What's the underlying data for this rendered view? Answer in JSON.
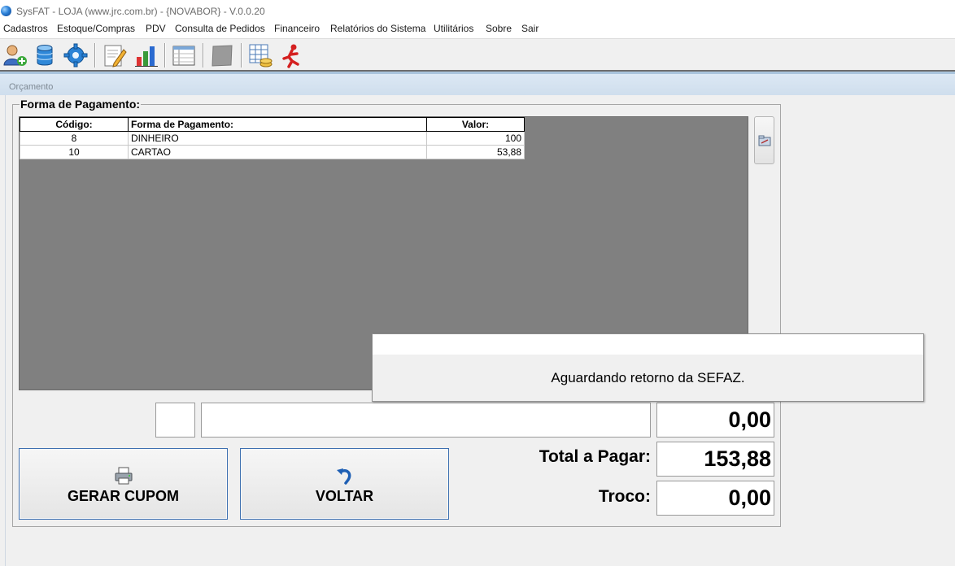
{
  "window": {
    "title": "SysFAT - LOJA (www.jrc.com.br) - {NOVABOR} - V.0.0.20"
  },
  "menu": [
    "Cadastros",
    "Estoque/Compras",
    "PDV",
    "Consulta de Pedidos",
    "Financeiro",
    "Relatórios do Sistema",
    "Utilitários",
    "Sobre",
    "Sair"
  ],
  "toolbar": {
    "icons": [
      "user-add-icon",
      "database-icon",
      "gear-icon",
      "edit-document-icon",
      "bar-chart-icon",
      "report-table-icon",
      "blank-icon",
      "spreadsheet-coins-icon",
      "exit-runner-icon"
    ]
  },
  "child_window": {
    "title": "Orçamento"
  },
  "payment": {
    "group_title": "Forma de Pagamento:",
    "columns": [
      "Código:",
      "Forma de Pagamento:",
      "Valor:"
    ],
    "rows": [
      {
        "code": "8",
        "method": "DINHEIRO",
        "value": "100"
      },
      {
        "code": "10",
        "method": "CARTAO",
        "value": "53,88"
      }
    ]
  },
  "entry": {
    "code": "",
    "description": "",
    "amount": "0,00"
  },
  "totals": {
    "total_label": "Total a Pagar:",
    "total_value": "153,88",
    "change_label": "Troco:",
    "change_value": "0,00"
  },
  "buttons": {
    "generate": "GERAR CUPOM",
    "back": "VOLTAR"
  },
  "popup": {
    "message": "Aguardando retorno da SEFAZ."
  },
  "colors": {
    "grid_bg": "#808080",
    "button_border": "#3d6fb0",
    "child_title_bg": "#dce8f4"
  }
}
